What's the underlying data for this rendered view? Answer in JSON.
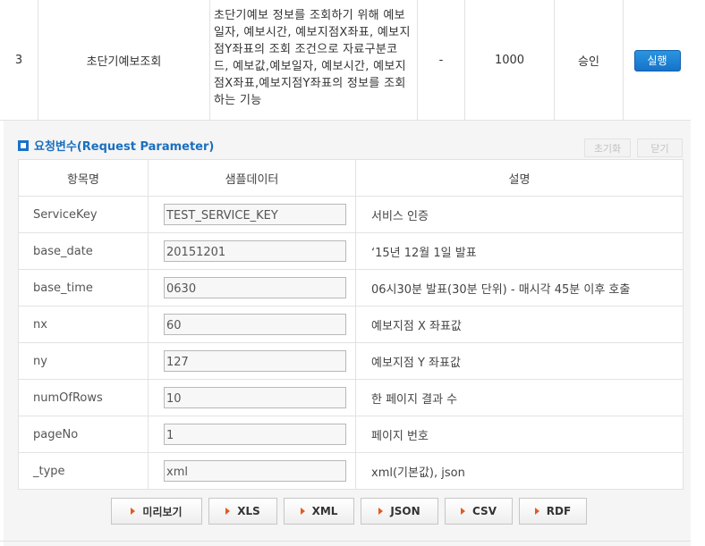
{
  "operation": {
    "number": "3",
    "name": "초단기예보조회",
    "description": "초단기예보 정보를 조회하기 위해 예보일자, 예보시간, 예보지점X좌표, 예보지점Y좌표의 조회 조건으로 자료구분코드, 예보값,예보일자, 예보시간, 예보지점X좌표,예보지점Y좌표의 정보를 조회하는 기능",
    "dash": "-",
    "traffic": "1000",
    "status": "승인",
    "run_label": "실행"
  },
  "panel": {
    "title": "요청변수(Request Parameter)",
    "reset_label": "초기화",
    "close_label": "닫기",
    "headers": [
      "항목명",
      "샘플데이터",
      "설명"
    ],
    "rows": [
      {
        "name": "ServiceKey",
        "value": "TEST_SERVICE_KEY",
        "desc": "서비스 인증"
      },
      {
        "name": "base_date",
        "value": "20151201",
        "desc": "‘15년 12월 1일 발표"
      },
      {
        "name": "base_time",
        "value": "0630",
        "desc": "06시30분 발표(30분 단위) - 매시각 45분 이후 호출"
      },
      {
        "name": "nx",
        "value": "60",
        "desc": "예보지점 X 좌표값"
      },
      {
        "name": "ny",
        "value": "127",
        "desc": "예보지점 Y 좌표값"
      },
      {
        "name": "numOfRows",
        "value": "10",
        "desc": "한 페이지 결과 수"
      },
      {
        "name": "pageNo",
        "value": "1",
        "desc": "페이지 번호"
      },
      {
        "name": "_type",
        "value": "xml",
        "desc": "xml(기본값), json"
      }
    ]
  },
  "formats": [
    {
      "label": "미리보기"
    },
    {
      "label": "XLS"
    },
    {
      "label": "XML"
    },
    {
      "label": "JSON"
    },
    {
      "label": "CSV"
    },
    {
      "label": "RDF"
    }
  ],
  "colors": {
    "accent": "#1a73c8",
    "run_button": "#1f85d6",
    "format_arrow": "#e25a21"
  }
}
